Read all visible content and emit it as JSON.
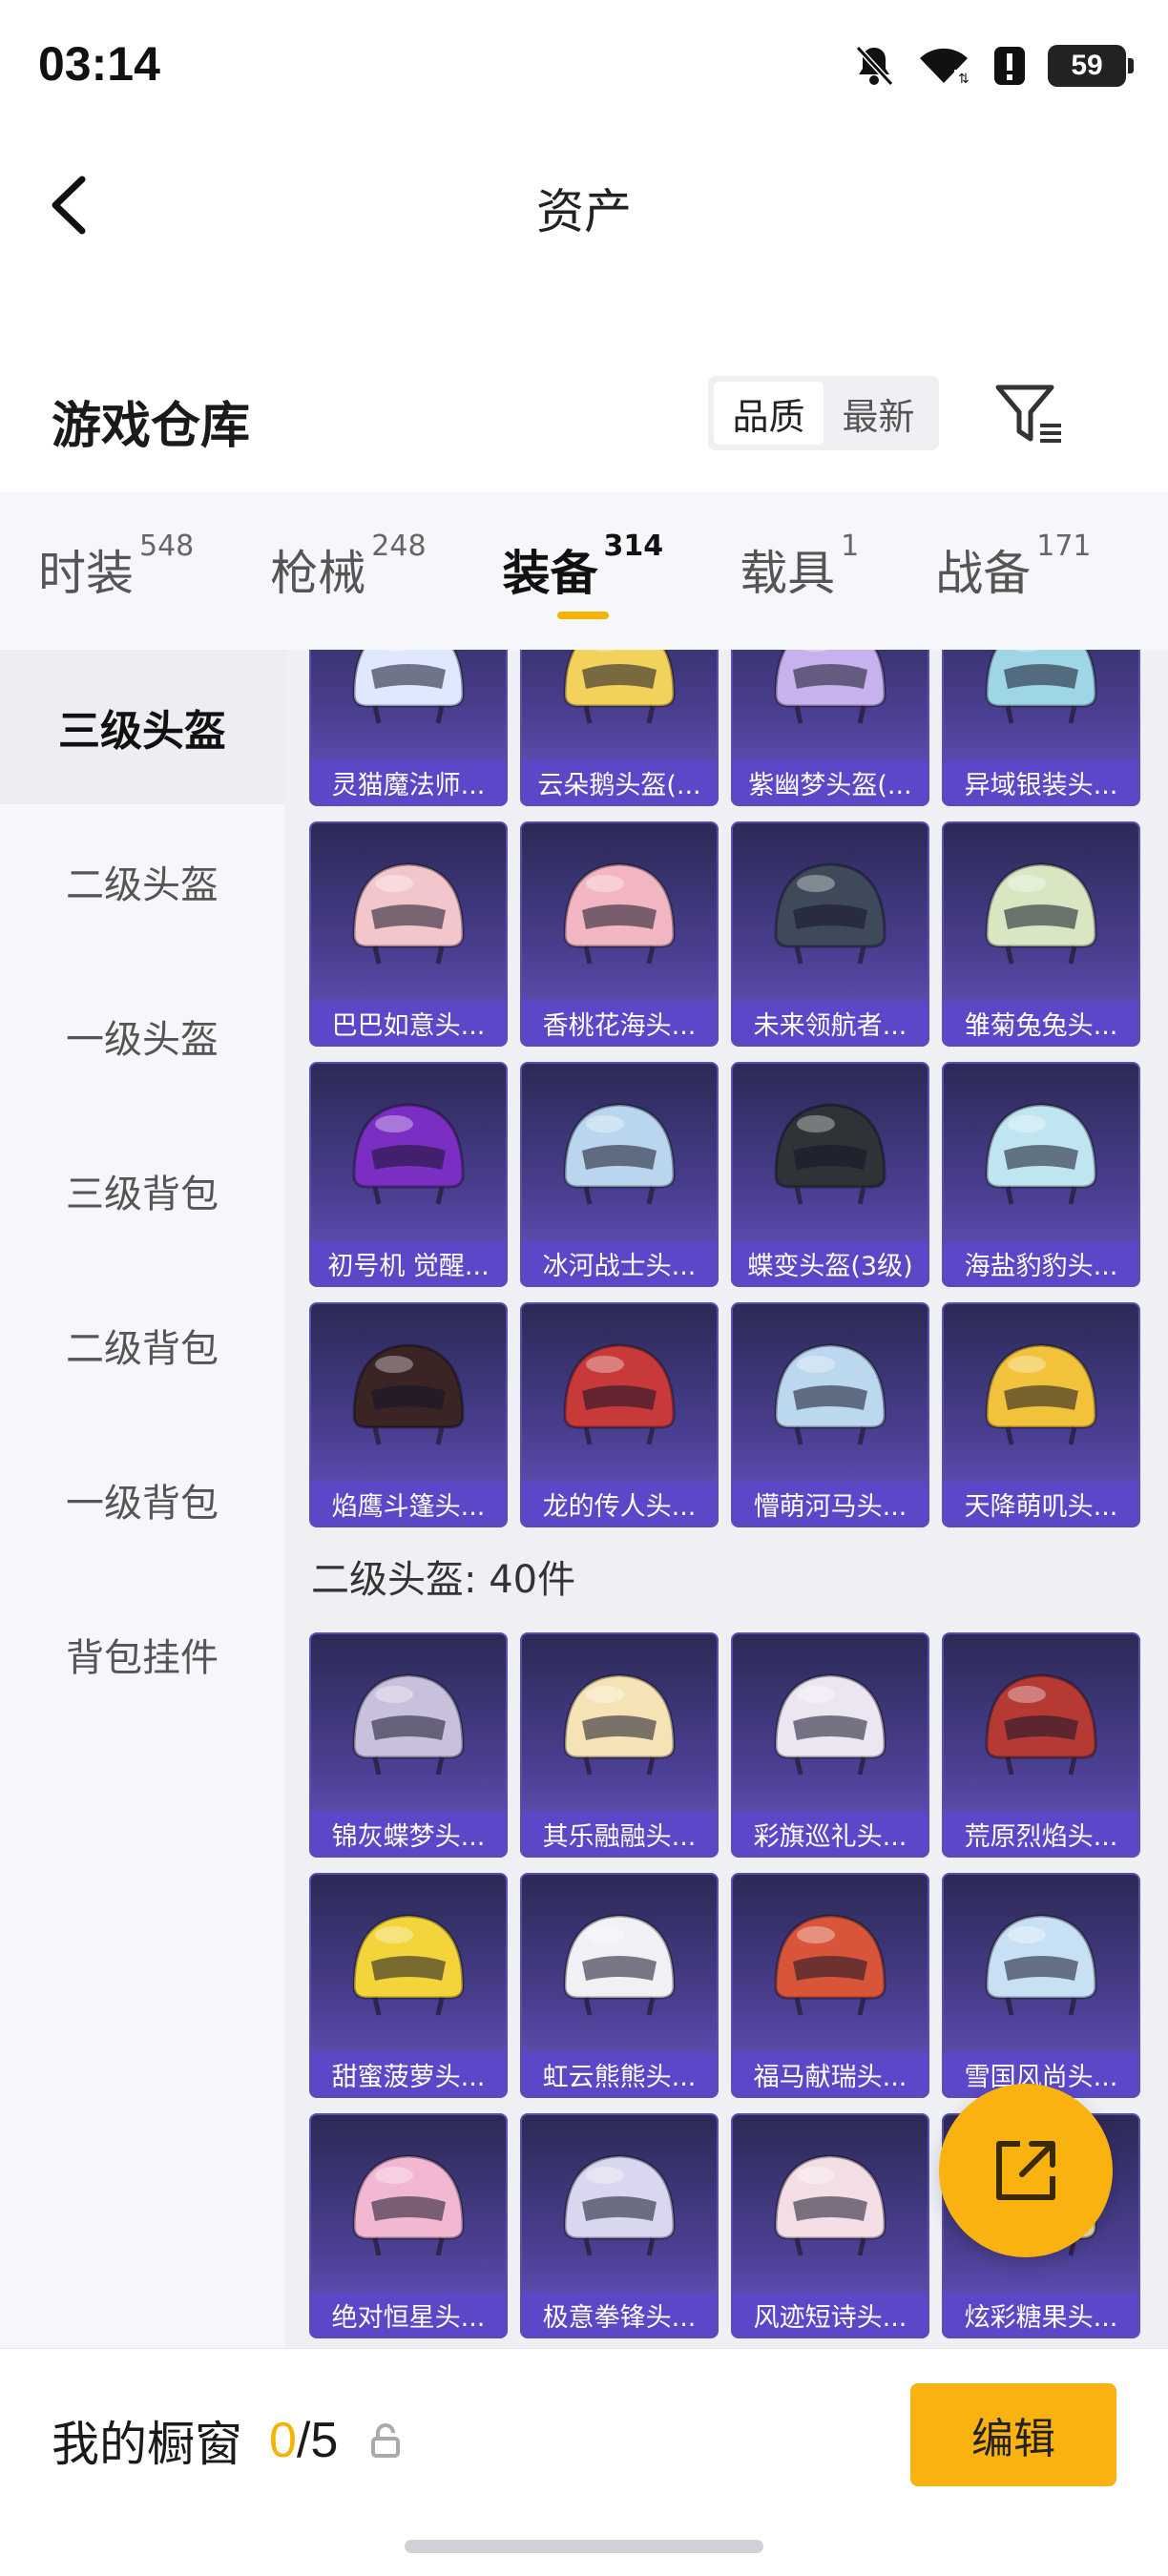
{
  "status_bar": {
    "time": "03:14",
    "battery": "59"
  },
  "nav": {
    "title": "资产"
  },
  "warehouse": {
    "title": "游戏仓库",
    "sort_options": [
      "品质",
      "最新"
    ],
    "active_sort": "品质"
  },
  "tabs": [
    {
      "label": "时装",
      "count": "548"
    },
    {
      "label": "枪械",
      "count": "248"
    },
    {
      "label": "装备",
      "count": "314",
      "active": true
    },
    {
      "label": "载具",
      "count": "1"
    },
    {
      "label": "战备",
      "count": "171"
    }
  ],
  "sidebar": {
    "items": [
      {
        "label": "三级头盔",
        "active": true
      },
      {
        "label": "二级头盔"
      },
      {
        "label": "一级头盔"
      },
      {
        "label": "三级背包"
      },
      {
        "label": "二级背包"
      },
      {
        "label": "一级背包"
      },
      {
        "label": "背包挂件"
      }
    ]
  },
  "grid": {
    "level3": [
      {
        "label": "灵猫魔法师...",
        "color": "#dfe8ff"
      },
      {
        "label": "云朵鹅头盔(...",
        "color": "#f2d25a"
      },
      {
        "label": "紫幽梦头盔(...",
        "color": "#c7b2ee"
      },
      {
        "label": "异域银装头...",
        "color": "#9fd6e6"
      },
      {
        "label": "巴巴如意头...",
        "color": "#f3c6cc"
      },
      {
        "label": "香桃花海头...",
        "color": "#f2b6c2"
      },
      {
        "label": "未来领航者...",
        "color": "#3e4a5a"
      },
      {
        "label": "雏菊兔兔头...",
        "color": "#d8e6c2"
      },
      {
        "label": "初号机 觉醒...",
        "color": "#7a2fc2"
      },
      {
        "label": "冰河战士头...",
        "color": "#b9d6ee"
      },
      {
        "label": "蝶变头盔(3级)",
        "color": "#2f3338"
      },
      {
        "label": "海盐豹豹头...",
        "color": "#bfe5f1"
      },
      {
        "label": "焰鹰斗篷头...",
        "color": "#3a2424"
      },
      {
        "label": "龙的传人头...",
        "color": "#c83a3a"
      },
      {
        "label": "懵萌河马头...",
        "color": "#bcd8ee"
      },
      {
        "label": "天降萌叽头...",
        "color": "#f2c23a"
      }
    ],
    "level2_title": "二级头盔: 40件",
    "level2": [
      {
        "label": "锦灰蝶梦头...",
        "color": "#c9c0de"
      },
      {
        "label": "其乐融融头...",
        "color": "#f5e3b5"
      },
      {
        "label": "彩旗巡礼头...",
        "color": "#ece6f2"
      },
      {
        "label": "荒原烈焰头...",
        "color": "#b53a34"
      },
      {
        "label": "甜蜜菠萝头...",
        "color": "#f3d43a"
      },
      {
        "label": "虹云熊熊头...",
        "color": "#f1f0f5"
      },
      {
        "label": "福马献瑞头...",
        "color": "#d9553a"
      },
      {
        "label": "雪国风尚头...",
        "color": "#c8e0f3"
      },
      {
        "label": "绝对恒星头...",
        "color": "#f2b7d3"
      },
      {
        "label": "极意拳锋头...",
        "color": "#d8d7ef"
      },
      {
        "label": "风迹短诗头...",
        "color": "#f4dee6"
      },
      {
        "label": "炫彩糖果头...",
        "color": "#f6e0b8"
      }
    ]
  },
  "bottom": {
    "label": "我的橱窗",
    "count_current": "0",
    "count_total": "/5",
    "edit_label": "编辑"
  }
}
